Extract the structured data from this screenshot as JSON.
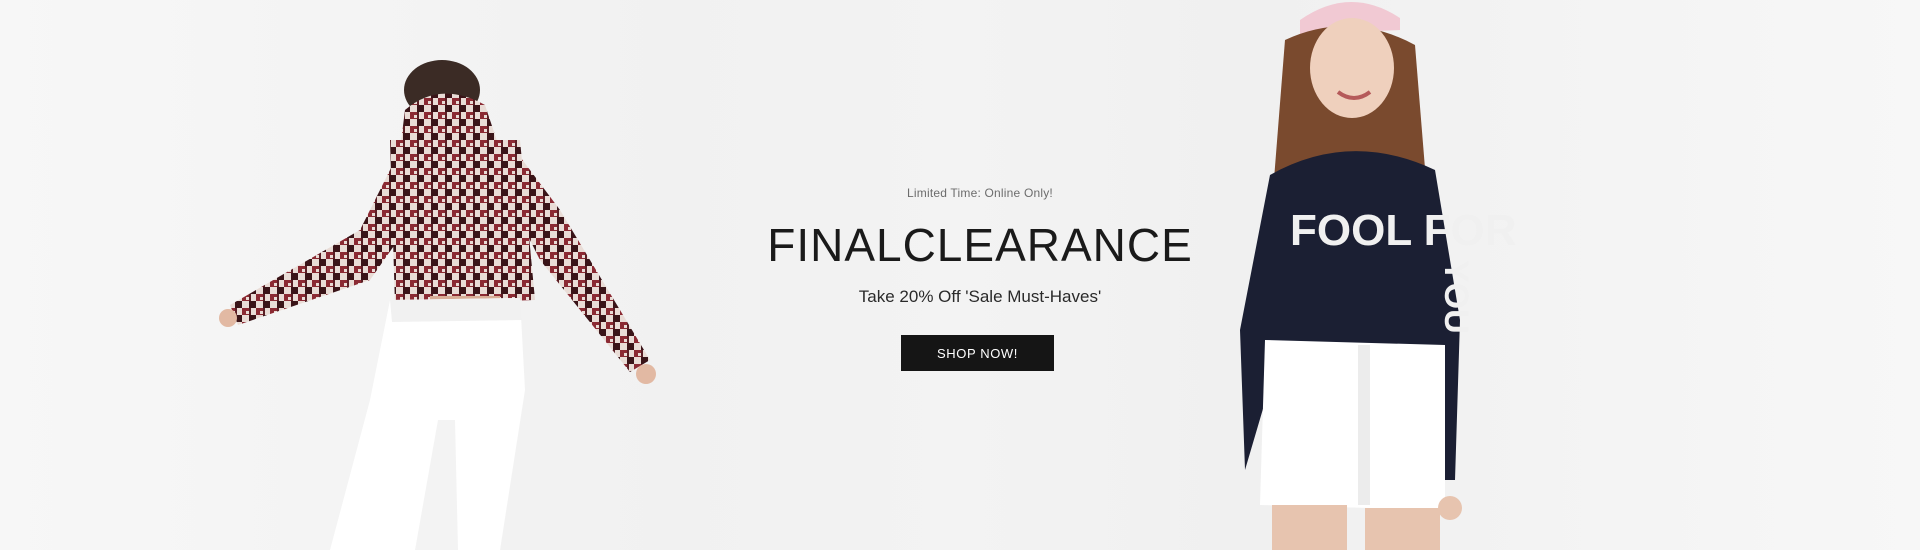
{
  "hero": {
    "kicker": "Limited Time: Online Only!",
    "headline": "FINALCLEARANCE",
    "subline": "Take 20% Off 'Sale Must-Haves'",
    "cta_label": "SHOP NOW!",
    "sweater_text_chest": "FOOL FOR",
    "sweater_text_sleeve": "YOU",
    "colors": {
      "background": "#f4f4f4",
      "button": "#151515",
      "button_text": "#ffffff",
      "plaid_red": "#8b2a33",
      "sweater_navy": "#1b1f33",
      "cap_pink": "#f1c9d3"
    }
  }
}
